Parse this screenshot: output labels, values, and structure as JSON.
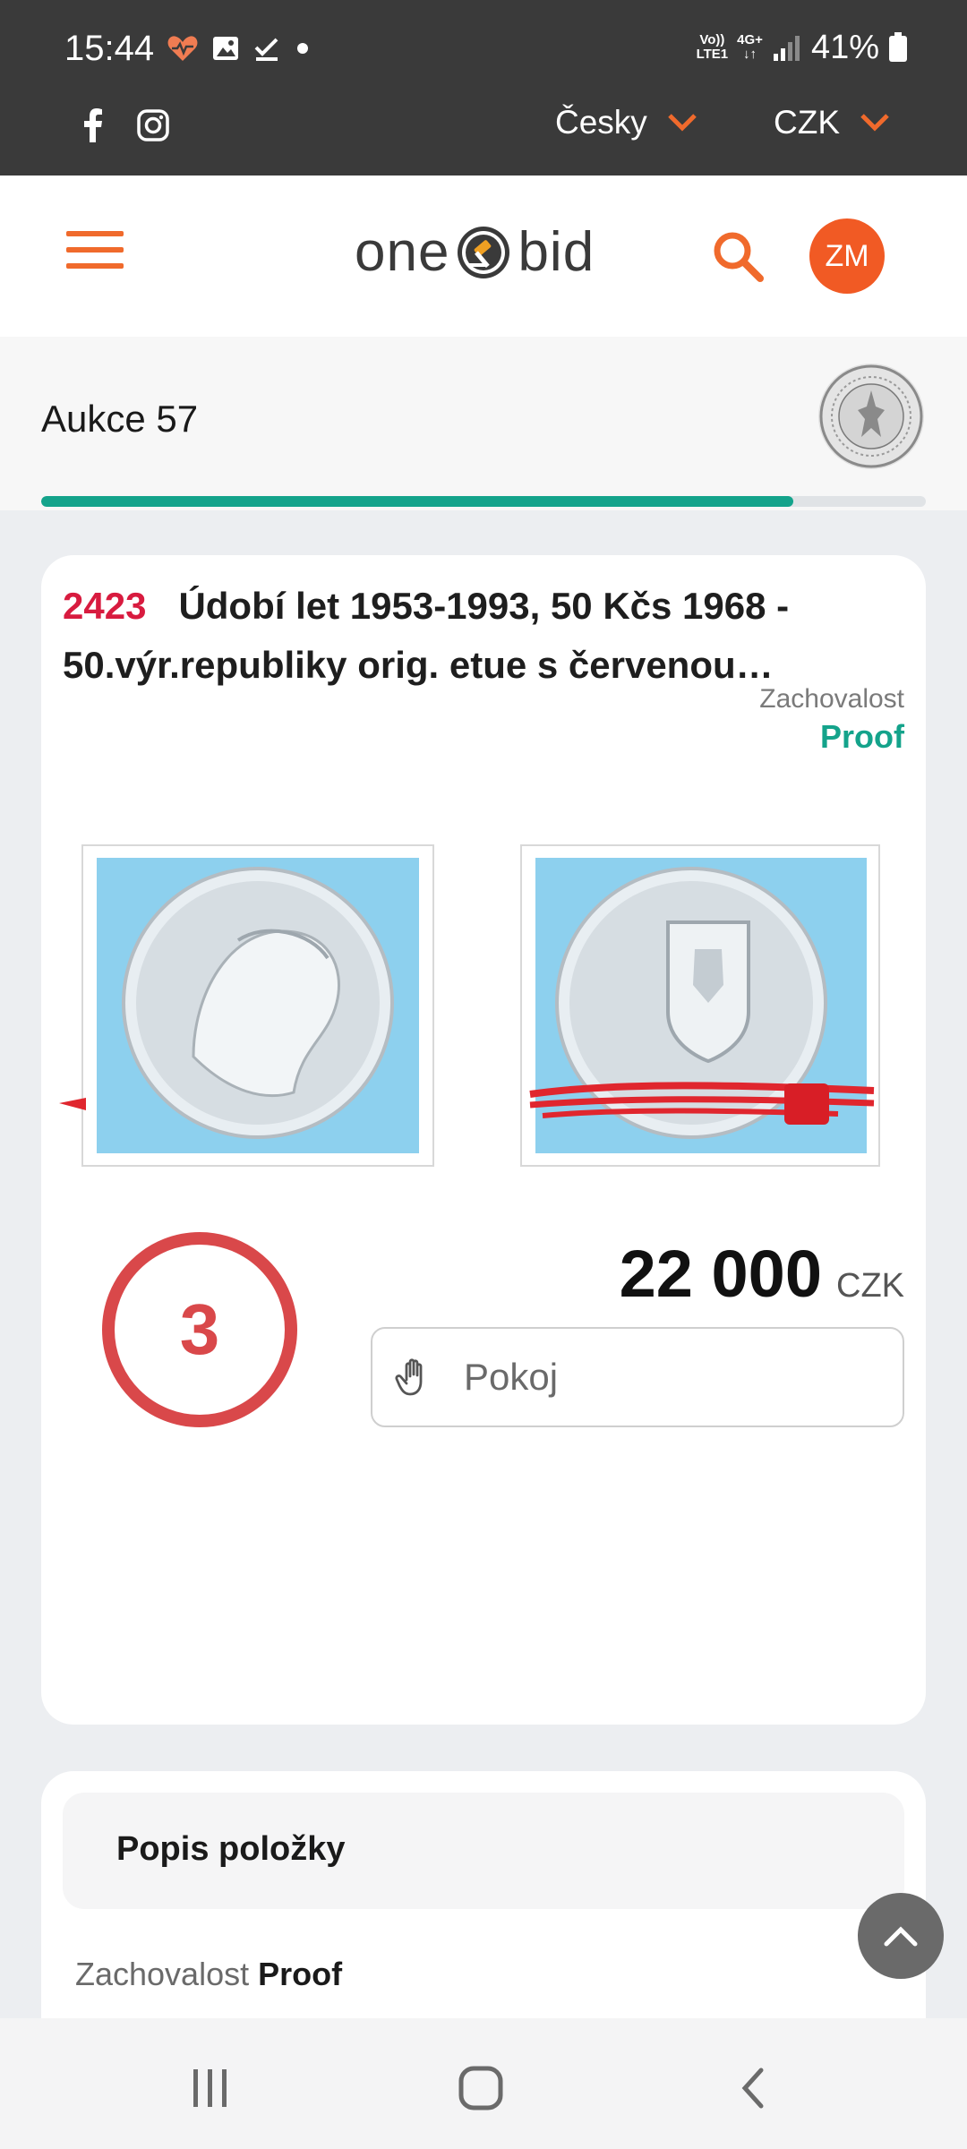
{
  "status_bar": {
    "time": "15:44",
    "network_top": "Vo))",
    "network_bottom": "LTE1",
    "signal_type": "4G+",
    "battery": "41%"
  },
  "top_bar": {
    "language": "Česky",
    "currency": "CZK",
    "social_icons": [
      "facebook-icon",
      "instagram-icon"
    ]
  },
  "header": {
    "logo_left": "one",
    "logo_right": "bid",
    "avatar_initials": "ZM"
  },
  "auction": {
    "title": "Aukce 57",
    "progress_fraction": 0.85
  },
  "lot": {
    "number": "2423",
    "title": "Údobí let 1953-1993, 50 Kčs 1968 - 50.výr.republiky orig. etue s červenou…",
    "condition_label": "Zachovalost",
    "condition_value": "Proof",
    "countdown": "3",
    "price": "22 000",
    "currency": "CZK",
    "bid_placeholder": "Pokoj"
  },
  "description": {
    "header": "Popis položky",
    "condition_label": "Zachovalost",
    "condition_value": "Proof"
  },
  "colors": {
    "accent_orange": "#f06a2c",
    "lot_red": "#d81b3f",
    "proof_teal": "#14a38b",
    "countdown_red": "#d9484a"
  }
}
